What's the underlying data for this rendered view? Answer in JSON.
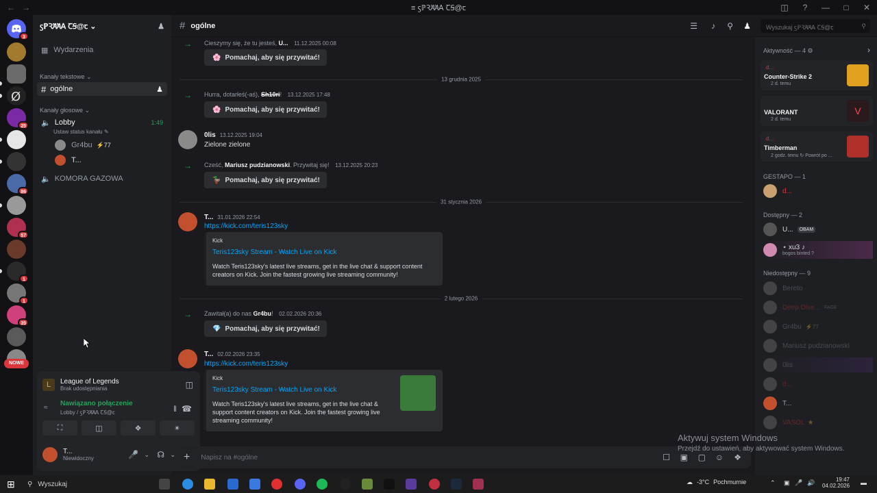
{
  "window": {
    "title": "ꚃℙꝚꞺꞺꓮ ꞆꞨ@ꞇ"
  },
  "server_badges": [
    "3",
    "25",
    "86",
    "57",
    "1",
    "1",
    "35"
  ],
  "new_label": "NOWE",
  "guild": {
    "name": "ꚃℙꝚꞺꞺꓮ ꞆꞨ@ꞇ",
    "events_label": "Wydarzenia",
    "text_category": "Kanały tekstowe",
    "text_channel": "ogólne",
    "voice_category": "Kanały głosowe",
    "voice_channel": "Lobby",
    "voice_timer": "1:49",
    "voice_status": "Ustaw status kanału",
    "voice_members": [
      {
        "name": "Gr4bu",
        "tag": "⚡77"
      },
      {
        "name": "T..."
      }
    ],
    "voice_channel_2": "KOMORA GAZOWA"
  },
  "user_panel": {
    "activity_title": "League of Legends",
    "activity_sub": "Brak udostępniania",
    "conn_title": "Nawiązano połączenie",
    "conn_sub": "Lobby / ꚃℙꝚꞺꞺꓮ ꞆꞨ@ꞇ",
    "me_name": "T...",
    "me_status": "Niewidoczny"
  },
  "header": {
    "channel": "ogólne",
    "search_placeholder": "Wyszukaj ꚃℙꝚꞺꞺꓮ ꞆꞨ@ꞇ"
  },
  "messages": {
    "m1_text": "Cieszymy się, że tu jesteś,",
    "m1_user": "U...",
    "m1_time": "11.12.2025 00:08",
    "wave_label": "Pomachaj, aby się przywitać!",
    "div1": "13 grudnia 2025",
    "m2_text": "Hurra, dotarłeś(-aś),",
    "m2_user": "Sh10ri",
    "m2_time": "13.12.2025 17:48",
    "m3_author": "0lis",
    "m3_time": "13.12.2025 19:04",
    "m3_text": "Zielone zielone",
    "m4_text": "Cześć,",
    "m4_user": "Mariusz pudzianowski",
    "m4_text2": ". Przywitaj się!",
    "m4_time": "13.12.2025 20:23",
    "div2": "31 stycznia 2026",
    "m5_author": "T...",
    "m5_time": "31.01.2026 22:54",
    "m5_link": "https://kick.com/teris123sky",
    "embed_provider": "Kick",
    "embed_title": "Teris123sky Stream - Watch Live on Kick",
    "embed_desc": "Watch Teris123sky's latest live streams, get in the live chat & support content creators on Kick. Join the fastest growing live streaming community!",
    "div3": "2 lutego 2026",
    "m6_text": "Zawitał(a) do nas",
    "m6_user": "Gr4bu",
    "m6_time": "02.02.2026 20:36",
    "m7_author": "T...",
    "m7_time": "02.02.2026 23:35",
    "m7_link": "https://kick.com/teris123sky"
  },
  "composer": {
    "placeholder": "Napisz na #ogólne"
  },
  "members": {
    "activity_head": "Aktywność — 4",
    "games": [
      {
        "user": "d...",
        "game": "Counter-Strike 2",
        "time": "2 d. temu"
      },
      {
        "user": "",
        "game": "VALORANT",
        "time": "2 d. temu"
      },
      {
        "user": "d...",
        "game": "Timberman",
        "time": "2 godz. temu",
        "extra": "Powrót po ..."
      }
    ],
    "gestapo_head": "GESTAPO — 1",
    "gestapo": [
      "d..."
    ],
    "online_head": "Dostępny — 2",
    "online": [
      {
        "name": "U...",
        "tag": "OBAM"
      },
      {
        "name": "⋆ xu3 ♪",
        "status": "bogos binted ?"
      }
    ],
    "offline_head": "Niedostępny — 9",
    "offline": [
      {
        "name": "Bereto"
      },
      {
        "name": "Deep Dive...",
        "tag": "FAGE"
      },
      {
        "name": "Gr4bu",
        "tag": "⚡77"
      },
      {
        "name": "Mariusz pudzianowski"
      },
      {
        "name": "0lis"
      },
      {
        "name": "d..."
      },
      {
        "name": "T..."
      },
      {
        "name": "VASOL"
      }
    ]
  },
  "watermark": {
    "title": "Aktywuj system Windows",
    "sub": "Przejdź do ustawień, aby aktywować system Windows."
  },
  "taskbar": {
    "search": "Wyszukaj",
    "weather": "-3°C",
    "weather_desc": "Pochmurnie",
    "time": "19:47",
    "date": "04.02.2026"
  }
}
